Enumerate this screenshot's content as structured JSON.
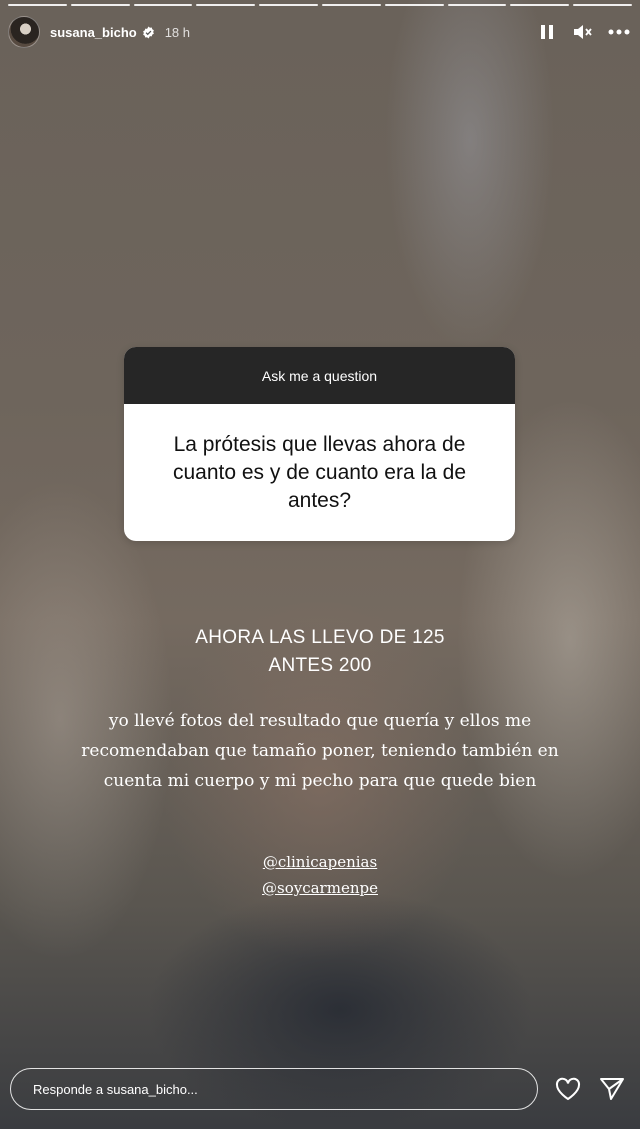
{
  "header": {
    "username": "susana_bicho",
    "time": "18 h",
    "verified_icon": "verified-badge-icon",
    "icons": [
      "pause-icon",
      "mute-icon",
      "more-options-icon"
    ]
  },
  "question_card": {
    "header": "Ask me a question",
    "question": "La prótesis que llevas ahora de cuanto es y de cuanto era la de antes?"
  },
  "answer": {
    "line1": "AHORA LAS LLEVO DE 125",
    "line2": "ANTES 200"
  },
  "note": "yo llevé fotos del resultado que quería y ellos me recomendaban que tamaño poner, teniendo también en cuenta mi cuerpo y mi pecho para que quede bien",
  "mentions": [
    "@clinicapenias",
    "@soycarmenpe"
  ],
  "reply": {
    "placeholder": "Responde a susana_bicho..."
  },
  "reply_icons": [
    "heart-icon",
    "send-icon"
  ],
  "colors": {
    "card_header_bg": "#262626",
    "card_body_bg": "#ffffff",
    "text_light": "#ffffff"
  }
}
